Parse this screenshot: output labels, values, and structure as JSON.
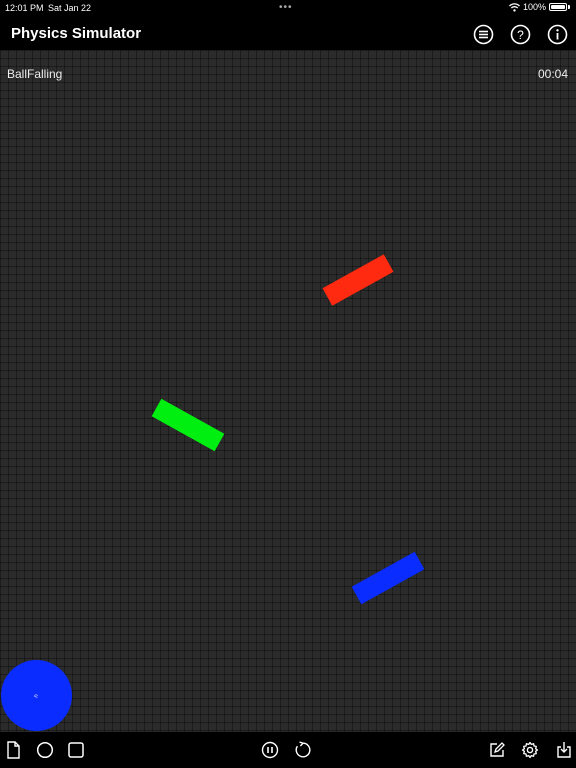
{
  "status": {
    "time": "12:01 PM",
    "date": "Sat Jan 22",
    "battery": "100%"
  },
  "header": {
    "title": "Physics Simulator",
    "icons": [
      "list-icon",
      "help-icon",
      "info-icon"
    ]
  },
  "scene": {
    "name": "BallFalling",
    "timer": "00:04",
    "bodies": [
      {
        "name": "red-box",
        "color": "#ff2a10"
      },
      {
        "name": "green-box",
        "color": "#00ee10"
      },
      {
        "name": "blue-box",
        "color": "#0a2cff"
      }
    ],
    "ball": {
      "color": "#0a2cff",
      "label": "n"
    }
  },
  "toolbar": {
    "left_icons": [
      "new-document-icon",
      "circle-tool-icon",
      "square-tool-icon"
    ],
    "center_icons": [
      "pause-icon",
      "reset-icon"
    ],
    "right_icons": [
      "edit-icon",
      "settings-icon",
      "export-icon"
    ]
  }
}
